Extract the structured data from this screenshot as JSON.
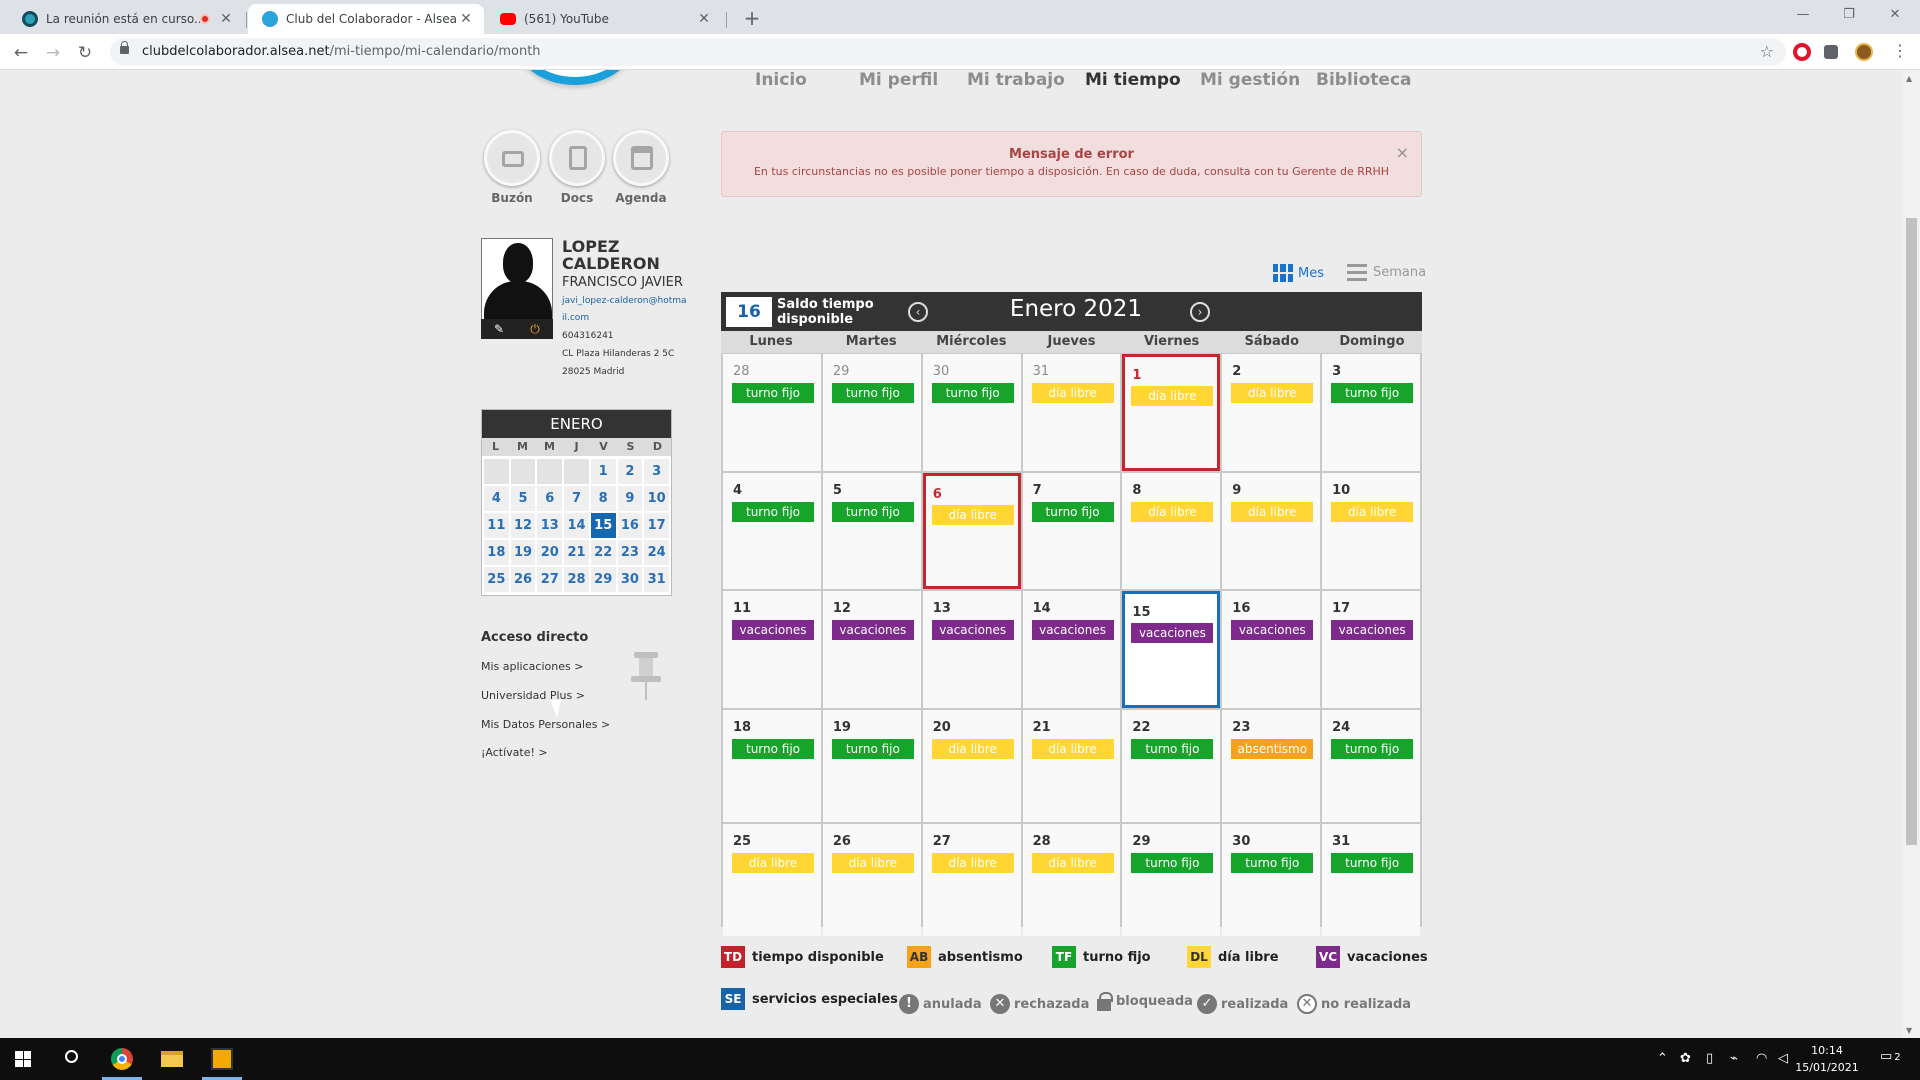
{
  "browser": {
    "tabs": [
      {
        "title": "La reunión está en curso...",
        "recording": true
      },
      {
        "title": "Club del Colaborador - Alsea",
        "active": true
      },
      {
        "title": "(561) YouTube"
      }
    ],
    "url_host": "clubdelcolaborador.alsea.net",
    "url_path": "/mi-tiempo/mi-calendario/month"
  },
  "nav": {
    "items": [
      "Inicio",
      "Mi perfil",
      "Mi trabajo",
      "Mi tiempo",
      "Mi gestión",
      "Biblioteca"
    ],
    "current": "Mi tiempo"
  },
  "quick": {
    "buzon": "Buzón",
    "docs": "Docs",
    "agenda": "Agenda"
  },
  "profile": {
    "lastname1": "LOPEZ",
    "lastname2": "CALDERON",
    "firstname": "FRANCISCO JAVIER",
    "email": "javi_lopez-calderon@hotmail.com",
    "phone": "604316241",
    "address1": "CL Plaza Hilanderas 2 5C",
    "address2": "28025 Madrid"
  },
  "mini_calendar": {
    "month": "ENERO",
    "days_header": [
      "L",
      "M",
      "M",
      "J",
      "V",
      "S",
      "D"
    ],
    "cells": [
      "",
      "",
      "",
      "",
      "1",
      "2",
      "3",
      "4",
      "5",
      "6",
      "7",
      "8",
      "9",
      "10",
      "11",
      "12",
      "13",
      "14",
      "15",
      "16",
      "17",
      "18",
      "19",
      "20",
      "21",
      "22",
      "23",
      "24",
      "25",
      "26",
      "27",
      "28",
      "29",
      "30",
      "31"
    ],
    "today": "15"
  },
  "direct_access": {
    "title": "Acceso directo",
    "links": [
      "Mis aplicaciones >",
      "Universidad Plus >",
      "Mis Datos Personales >",
      "¡Actívate! >"
    ]
  },
  "error": {
    "title": "Mensaje de error",
    "message": "En tus circunstancias no es posible poner tiempo a disposición. En caso de duda, consulta con tu Gerente de RRHH",
    "close": "×"
  },
  "view_switch": {
    "month": "Mes",
    "week": "Semana"
  },
  "calendar": {
    "saldo_value": "16",
    "saldo_label": "Saldo tiempo disponible",
    "title": "Enero 2021",
    "prev": "‹",
    "next": "›",
    "weekdays": [
      "Lunes",
      "Martes",
      "Miércoles",
      "Jueves",
      "Viernes",
      "Sábado",
      "Domingo"
    ],
    "days": [
      {
        "n": "28",
        "label": "turno fijo",
        "prev": true
      },
      {
        "n": "29",
        "label": "turno fijo",
        "prev": true
      },
      {
        "n": "30",
        "label": "turno fijo",
        "prev": true
      },
      {
        "n": "31",
        "label": "día libre",
        "prev": true
      },
      {
        "n": "1",
        "label": "día libre",
        "mark": "red"
      },
      {
        "n": "2",
        "label": "día libre"
      },
      {
        "n": "3",
        "label": "turno fijo"
      },
      {
        "n": "4",
        "label": "turno fijo"
      },
      {
        "n": "5",
        "label": "turno fijo"
      },
      {
        "n": "6",
        "label": "día libre",
        "mark": "red"
      },
      {
        "n": "7",
        "label": "turno fijo"
      },
      {
        "n": "8",
        "label": "día libre"
      },
      {
        "n": "9",
        "label": "día libre"
      },
      {
        "n": "10",
        "label": "día libre"
      },
      {
        "n": "11",
        "label": "vacaciones"
      },
      {
        "n": "12",
        "label": "vacaciones"
      },
      {
        "n": "13",
        "label": "vacaciones"
      },
      {
        "n": "14",
        "label": "vacaciones"
      },
      {
        "n": "15",
        "label": "vacaciones",
        "mark": "blue"
      },
      {
        "n": "16",
        "label": "vacaciones"
      },
      {
        "n": "17",
        "label": "vacaciones"
      },
      {
        "n": "18",
        "label": "turno fijo"
      },
      {
        "n": "19",
        "label": "turno fijo"
      },
      {
        "n": "20",
        "label": "día libre"
      },
      {
        "n": "21",
        "label": "día libre"
      },
      {
        "n": "22",
        "label": "turno fijo"
      },
      {
        "n": "23",
        "label": "absentismo"
      },
      {
        "n": "24",
        "label": "turno fijo"
      },
      {
        "n": "25",
        "label": "día libre"
      },
      {
        "n": "26",
        "label": "día libre"
      },
      {
        "n": "27",
        "label": "día libre"
      },
      {
        "n": "28",
        "label": "día libre"
      },
      {
        "n": "29",
        "label": "turno fijo"
      },
      {
        "n": "30",
        "label": "turno fijo"
      },
      {
        "n": "31",
        "label": "turno fijo"
      }
    ]
  },
  "colors": {
    "turno fijo": "#17a42b",
    "día libre": "#ffd633",
    "vacaciones": "#7d2a8c",
    "absentismo": "#f7a21b",
    "tiempo disponible": "#c4212a",
    "servicios especiales": "#1763a8"
  },
  "legend": [
    {
      "code": "TD",
      "label": "tiempo disponible"
    },
    {
      "code": "AB",
      "label": "absentismo"
    },
    {
      "code": "TF",
      "label": "turno fijo"
    },
    {
      "code": "DL",
      "label": "día libre"
    },
    {
      "code": "VC",
      "label": "vacaciones"
    },
    {
      "code": "SE",
      "label": "servicios especiales >"
    }
  ],
  "status_legend": [
    "anulada",
    "rechazada",
    "bloqueada",
    "realizada",
    "no realizada"
  ],
  "clock": {
    "time": "10:14",
    "date": "15/01/2021"
  },
  "tray": {
    "notifications": "2"
  }
}
